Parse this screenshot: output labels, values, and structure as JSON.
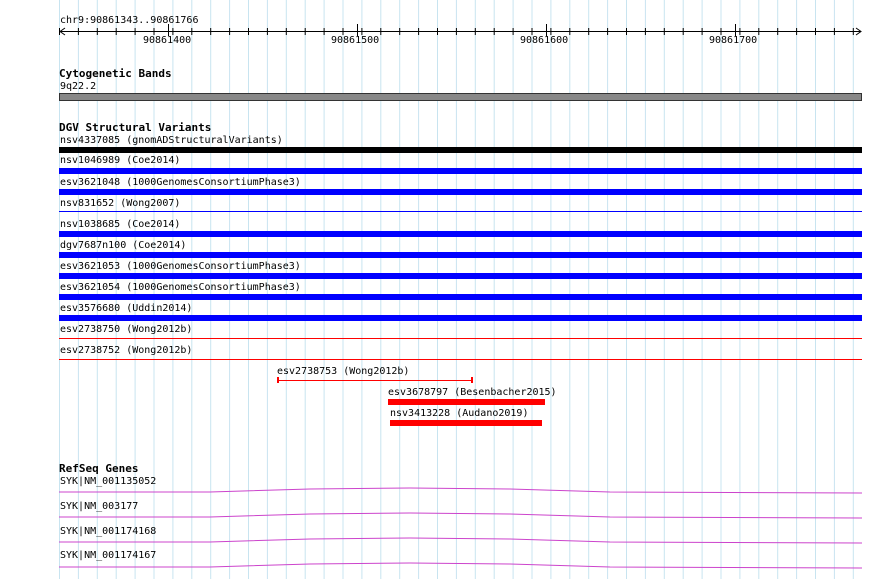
{
  "ruler": {
    "region": "chr9:90861343..90861766",
    "ticks": [
      "90861400",
      "90861500",
      "90861600",
      "90861700"
    ]
  },
  "cytoband": {
    "title": "Cytogenetic Bands",
    "band": "9q22.2"
  },
  "dgv": {
    "title": "DGV Structural Variants",
    "variants": [
      {
        "label": "nsv4337085 (gnomADStructuralVariants)",
        "color": "#000000",
        "style": "thick"
      },
      {
        "label": "nsv1046989 (Coe2014)",
        "color": "#0000ff",
        "style": "thick"
      },
      {
        "label": "esv3621048 (1000GenomesConsortiumPhase3)",
        "color": "#0000ff",
        "style": "thick"
      },
      {
        "label": "nsv831652 (Wong2007)",
        "color": "#0000ff",
        "style": "thin"
      },
      {
        "label": "nsv1038685 (Coe2014)",
        "color": "#0000ff",
        "style": "thick"
      },
      {
        "label": "dgv7687n100 (Coe2014)",
        "color": "#0000ff",
        "style": "thick"
      },
      {
        "label": "esv3621053 (1000GenomesConsortiumPhase3)",
        "color": "#0000ff",
        "style": "thick"
      },
      {
        "label": "esv3621054 (1000GenomesConsortiumPhase3)",
        "color": "#0000ff",
        "style": "thick"
      },
      {
        "label": "esv3576680 (Uddin2014)",
        "color": "#0000ff",
        "style": "thick"
      },
      {
        "label": "esv2738750 (Wong2012b)",
        "color": "#ff0000",
        "style": "thin"
      },
      {
        "label": "esv2738752 (Wong2012b)",
        "color": "#ff0000",
        "style": "thin"
      },
      {
        "label": "esv2738753 (Wong2012b)",
        "color": "#ff0000",
        "style": "capped"
      },
      {
        "label": "esv3678797 (Besenbacher2015)",
        "color": "#ff0000",
        "style": "thick"
      },
      {
        "label": "nsv3413228 (Audano2019)",
        "color": "#ff0000",
        "style": "thick"
      }
    ]
  },
  "refseq": {
    "title": "RefSeq Genes",
    "genes": [
      "SYK|NM_001135052",
      "SYK|NM_003177",
      "SYK|NM_001174168",
      "SYK|NM_001174167"
    ],
    "color": "#cc44cc"
  }
}
